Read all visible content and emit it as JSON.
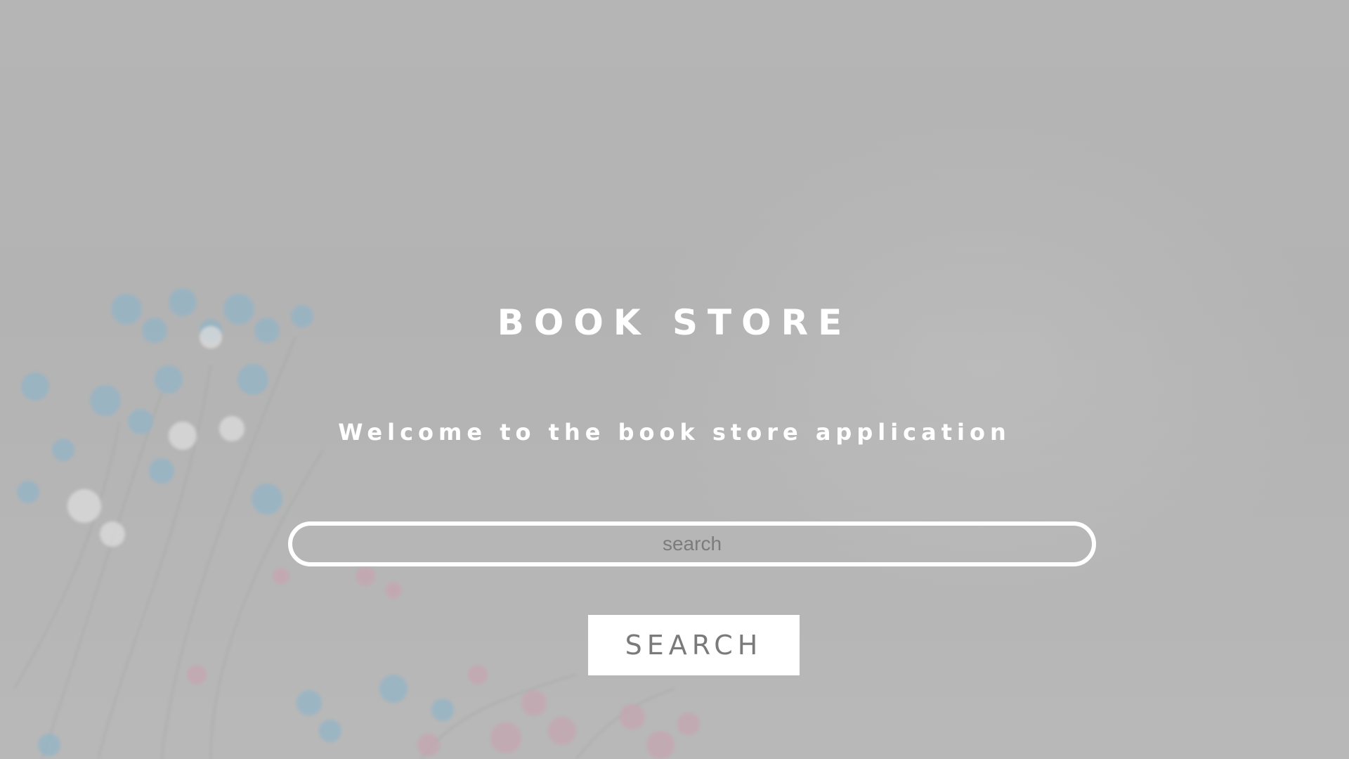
{
  "header": {
    "title": "BOOK STORE",
    "subtitle": "Welcome to the book store application"
  },
  "search": {
    "placeholder": "search",
    "value": "",
    "button_label": "SEARCH"
  },
  "colors": {
    "background": "#b4b4b4",
    "text": "#ffffff",
    "input_border": "#ffffff",
    "button_background": "#ffffff",
    "button_text": "#7a7a7a"
  }
}
